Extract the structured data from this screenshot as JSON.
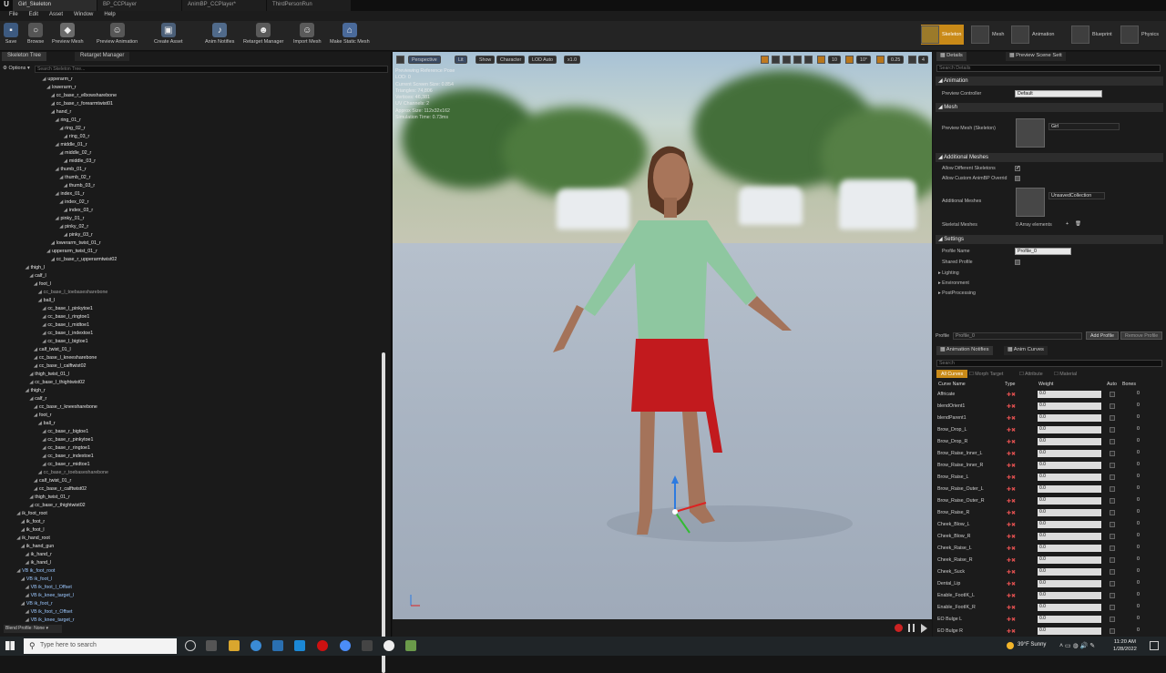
{
  "tabs": [
    {
      "label": "Girl_Skeleton",
      "active": true
    },
    {
      "label": "BP_CCPlayer",
      "active": false
    },
    {
      "label": "AnimBP_CCPlayer*",
      "active": false
    },
    {
      "label": "ThirdPersonRun",
      "active": false
    }
  ],
  "menu": [
    "File",
    "Edit",
    "Asset",
    "Window",
    "Help"
  ],
  "toolbar": {
    "save": "Save",
    "browse": "Browse",
    "preview_mesh": "Preview Mesh",
    "preview_animation": "Preview Animation",
    "create_asset": "Create Asset",
    "anim_notifies": "Anim Notifies",
    "retarget_manager": "Retarget Manager",
    "import_mesh": "Import Mesh",
    "make_static_mesh": "Make Static Mesh"
  },
  "modes": {
    "skeleton": "Skeleton",
    "mesh": "Mesh",
    "animation": "Animation",
    "blueprint": "Blueprint",
    "physics": "Physics"
  },
  "left": {
    "tab_tree": "Skeleton Tree",
    "tab_retarget": "Retarget Manager",
    "options": "Options",
    "search_placeholder": "Search Skeleton Tree...",
    "blend_profile": "Blend Profile: None",
    "bones": [
      {
        "name": "upperarm_r",
        "indent": 9,
        "kind": "bone"
      },
      {
        "name": "lowerarm_r",
        "indent": 10,
        "kind": "bone"
      },
      {
        "name": "cc_base_r_elbowsharebone",
        "indent": 11,
        "kind": "bone"
      },
      {
        "name": "cc_base_r_forearmtwist01",
        "indent": 11,
        "kind": "bone"
      },
      {
        "name": "hand_r",
        "indent": 11,
        "kind": "bone"
      },
      {
        "name": "ring_01_r",
        "indent": 12,
        "kind": "bone"
      },
      {
        "name": "ring_02_r",
        "indent": 13,
        "kind": "bone"
      },
      {
        "name": "ring_03_r",
        "indent": 14,
        "kind": "bone"
      },
      {
        "name": "middle_01_r",
        "indent": 12,
        "kind": "bone"
      },
      {
        "name": "middle_02_r",
        "indent": 13,
        "kind": "bone"
      },
      {
        "name": "middle_03_r",
        "indent": 14,
        "kind": "bone"
      },
      {
        "name": "thumb_01_r",
        "indent": 12,
        "kind": "bone"
      },
      {
        "name": "thumb_02_r",
        "indent": 13,
        "kind": "bone"
      },
      {
        "name": "thumb_03_r",
        "indent": 14,
        "kind": "bone"
      },
      {
        "name": "index_01_r",
        "indent": 12,
        "kind": "bone"
      },
      {
        "name": "index_02_r",
        "indent": 13,
        "kind": "bone"
      },
      {
        "name": "index_03_r",
        "indent": 14,
        "kind": "bone"
      },
      {
        "name": "pinky_01_r",
        "indent": 12,
        "kind": "bone"
      },
      {
        "name": "pinky_02_r",
        "indent": 13,
        "kind": "bone"
      },
      {
        "name": "pinky_03_r",
        "indent": 14,
        "kind": "bone"
      },
      {
        "name": "lowerarm_twist_01_r",
        "indent": 11,
        "kind": "bone"
      },
      {
        "name": "upperarm_twist_01_r",
        "indent": 10,
        "kind": "bone"
      },
      {
        "name": "cc_base_r_upperarmtwist02",
        "indent": 11,
        "kind": "bone"
      },
      {
        "name": "thigh_l",
        "indent": 5,
        "kind": "bone"
      },
      {
        "name": "calf_l",
        "indent": 6,
        "kind": "bone"
      },
      {
        "name": "foot_l",
        "indent": 7,
        "kind": "bone"
      },
      {
        "name": "cc_base_l_toebasesharebone",
        "indent": 8,
        "kind": "dim"
      },
      {
        "name": "ball_l",
        "indent": 8,
        "kind": "bone"
      },
      {
        "name": "cc_base_l_pinkytoe1",
        "indent": 9,
        "kind": "bone"
      },
      {
        "name": "cc_base_l_ringtoe1",
        "indent": 9,
        "kind": "bone"
      },
      {
        "name": "cc_base_l_midtoe1",
        "indent": 9,
        "kind": "bone"
      },
      {
        "name": "cc_base_l_indextoe1",
        "indent": 9,
        "kind": "bone"
      },
      {
        "name": "cc_base_l_bigtoe1",
        "indent": 9,
        "kind": "bone"
      },
      {
        "name": "calf_twist_01_l",
        "indent": 7,
        "kind": "bone"
      },
      {
        "name": "cc_base_l_kneesharebone",
        "indent": 7,
        "kind": "bone"
      },
      {
        "name": "cc_base_l_calftwist02",
        "indent": 7,
        "kind": "bone"
      },
      {
        "name": "thigh_twist_01_l",
        "indent": 6,
        "kind": "bone"
      },
      {
        "name": "cc_base_l_thightwist02",
        "indent": 6,
        "kind": "bone"
      },
      {
        "name": "thigh_r",
        "indent": 5,
        "kind": "bone"
      },
      {
        "name": "calf_r",
        "indent": 6,
        "kind": "bone"
      },
      {
        "name": "cc_base_r_kneesharebone",
        "indent": 7,
        "kind": "bone"
      },
      {
        "name": "foot_r",
        "indent": 7,
        "kind": "bone"
      },
      {
        "name": "ball_r",
        "indent": 8,
        "kind": "bone"
      },
      {
        "name": "cc_base_r_bigtoe1",
        "indent": 9,
        "kind": "bone"
      },
      {
        "name": "cc_base_r_pinkytoe1",
        "indent": 9,
        "kind": "bone"
      },
      {
        "name": "cc_base_r_ringtoe1",
        "indent": 9,
        "kind": "bone"
      },
      {
        "name": "cc_base_r_indextoe1",
        "indent": 9,
        "kind": "bone"
      },
      {
        "name": "cc_base_r_midtoe1",
        "indent": 9,
        "kind": "bone"
      },
      {
        "name": "cc_base_r_toebasesharebone",
        "indent": 8,
        "kind": "dim"
      },
      {
        "name": "calf_twist_01_r",
        "indent": 7,
        "kind": "bone"
      },
      {
        "name": "cc_base_r_calftwist02",
        "indent": 7,
        "kind": "bone"
      },
      {
        "name": "thigh_twist_01_r",
        "indent": 6,
        "kind": "bone"
      },
      {
        "name": "cc_base_r_thightwist02",
        "indent": 6,
        "kind": "bone"
      },
      {
        "name": "ik_foot_root",
        "indent": 3,
        "kind": "bone"
      },
      {
        "name": "ik_foot_r",
        "indent": 4,
        "kind": "bone"
      },
      {
        "name": "ik_foot_l",
        "indent": 4,
        "kind": "bone"
      },
      {
        "name": "ik_hand_root",
        "indent": 3,
        "kind": "bone"
      },
      {
        "name": "ik_hand_gun",
        "indent": 4,
        "kind": "bone"
      },
      {
        "name": "ik_hand_r",
        "indent": 5,
        "kind": "bone"
      },
      {
        "name": "ik_hand_l",
        "indent": 5,
        "kind": "bone"
      },
      {
        "name": "VB ik_foot_root",
        "indent": 3,
        "kind": "vb"
      },
      {
        "name": "VB ik_foot_l",
        "indent": 4,
        "kind": "vb"
      },
      {
        "name": "VB ik_foot_l_Offset",
        "indent": 5,
        "kind": "vb"
      },
      {
        "name": "VB ik_knee_target_l",
        "indent": 5,
        "kind": "vb"
      },
      {
        "name": "VB ik_foot_r",
        "indent": 4,
        "kind": "vb"
      },
      {
        "name": "VB ik_foot_r_Offset",
        "indent": 5,
        "kind": "vb"
      },
      {
        "name": "VB ik_knee_target_r",
        "indent": 5,
        "kind": "vb"
      }
    ]
  },
  "viewport": {
    "perspective": "Perspective",
    "lit": "Lit",
    "show": "Show",
    "character": "Character",
    "lod": "LOD Auto",
    "speed": "x1.0",
    "grid_snap": "10",
    "rot_snap": "10°",
    "scale_snap": "0.25",
    "cam_speed": "4",
    "stats": [
      "Previewing Reference Pose",
      "LOD: 0",
      "Current Screen Size: 0.854",
      "Triangles: 74,806",
      "Vertices: 46,381",
      "UV Channels: 2",
      "Approx Size: 112x32x162",
      "Simulation Time: 0.73ms"
    ]
  },
  "right": {
    "tab_details": "Details",
    "tab_scene": "Preview Scene Sett",
    "search_placeholder": "Search Details",
    "animation_hdr": "Animation",
    "preview_controller_lbl": "Preview Controller",
    "preview_controller_val": "Default",
    "mesh_hdr": "Mesh",
    "preview_mesh_lbl": "Preview Mesh (Skeleton)",
    "preview_mesh_val": "Girl",
    "additional_hdr": "Additional Meshes",
    "allow_diff_lbl": "Allow Different Skeletons",
    "allow_custom_lbl": "Allow Custom AnimBP Overrid",
    "additional_meshes_lbl": "Additional Meshes",
    "additional_meshes_val": "UnsavedCollection",
    "skeletal_meshes_lbl": "Skeletal Meshes",
    "skeletal_meshes_val": "0 Array elements",
    "settings_hdr": "Settings",
    "profile_name_lbl": "Profile Name",
    "profile_name_val": "Profile_0",
    "shared_profile_lbl": "Shared Profile",
    "lighting": "Lighting",
    "environment": "Environment",
    "postprocessing": "PostProcessing",
    "profile_lbl": "Profile",
    "profile_val": "Profile_0",
    "add_profile": "Add Profile",
    "remove_profile": "Remove Profile",
    "tab_notifies": "Animation Notifies",
    "tab_curves": "Anim Curves",
    "curve_search": "Search",
    "filters": [
      "All Curves",
      "Morph Target",
      "Attribute",
      "Material"
    ],
    "col_name": "Curve Name",
    "col_type": "Type",
    "col_weight": "Weight",
    "col_auto": "Auto",
    "col_bones": "Bones",
    "curves": [
      {
        "name": "Affricate",
        "weight": "0.0",
        "bones": "0"
      },
      {
        "name": "blendOrient1",
        "weight": "0.0",
        "bones": "0"
      },
      {
        "name": "blendParent1",
        "weight": "0.0",
        "bones": "0"
      },
      {
        "name": "Brow_Drop_L",
        "weight": "0.0",
        "bones": "0"
      },
      {
        "name": "Brow_Drop_R",
        "weight": "0.0",
        "bones": "0"
      },
      {
        "name": "Brow_Raise_Inner_L",
        "weight": "0.0",
        "bones": "0"
      },
      {
        "name": "Brow_Raise_Inner_R",
        "weight": "0.0",
        "bones": "0"
      },
      {
        "name": "Brow_Raise_L",
        "weight": "0.0",
        "bones": "0"
      },
      {
        "name": "Brow_Raise_Outer_L",
        "weight": "0.0",
        "bones": "0"
      },
      {
        "name": "Brow_Raise_Outer_R",
        "weight": "0.0",
        "bones": "0"
      },
      {
        "name": "Brow_Raise_R",
        "weight": "0.0",
        "bones": "0"
      },
      {
        "name": "Cheek_Blow_L",
        "weight": "0.0",
        "bones": "0"
      },
      {
        "name": "Cheek_Blow_R",
        "weight": "0.0",
        "bones": "0"
      },
      {
        "name": "Cheek_Raise_L",
        "weight": "0.0",
        "bones": "0"
      },
      {
        "name": "Cheek_Raise_R",
        "weight": "0.0",
        "bones": "0"
      },
      {
        "name": "Cheek_Suck",
        "weight": "0.0",
        "bones": "0"
      },
      {
        "name": "Dental_Lip",
        "weight": "0.0",
        "bones": "0"
      },
      {
        "name": "Enable_FootIK_L",
        "weight": "0.0",
        "bones": "0"
      },
      {
        "name": "Enable_FootIK_R",
        "weight": "0.0",
        "bones": "0"
      },
      {
        "name": "EO Bulge L",
        "weight": "0.0",
        "bones": "0"
      },
      {
        "name": "EO Bulge R",
        "weight": "0.0",
        "bones": "0"
      }
    ]
  },
  "taskbar": {
    "search_placeholder": "Type here to search",
    "weather": "39°F Sunny",
    "time": "11:20 AM",
    "date": "1/28/2022"
  }
}
